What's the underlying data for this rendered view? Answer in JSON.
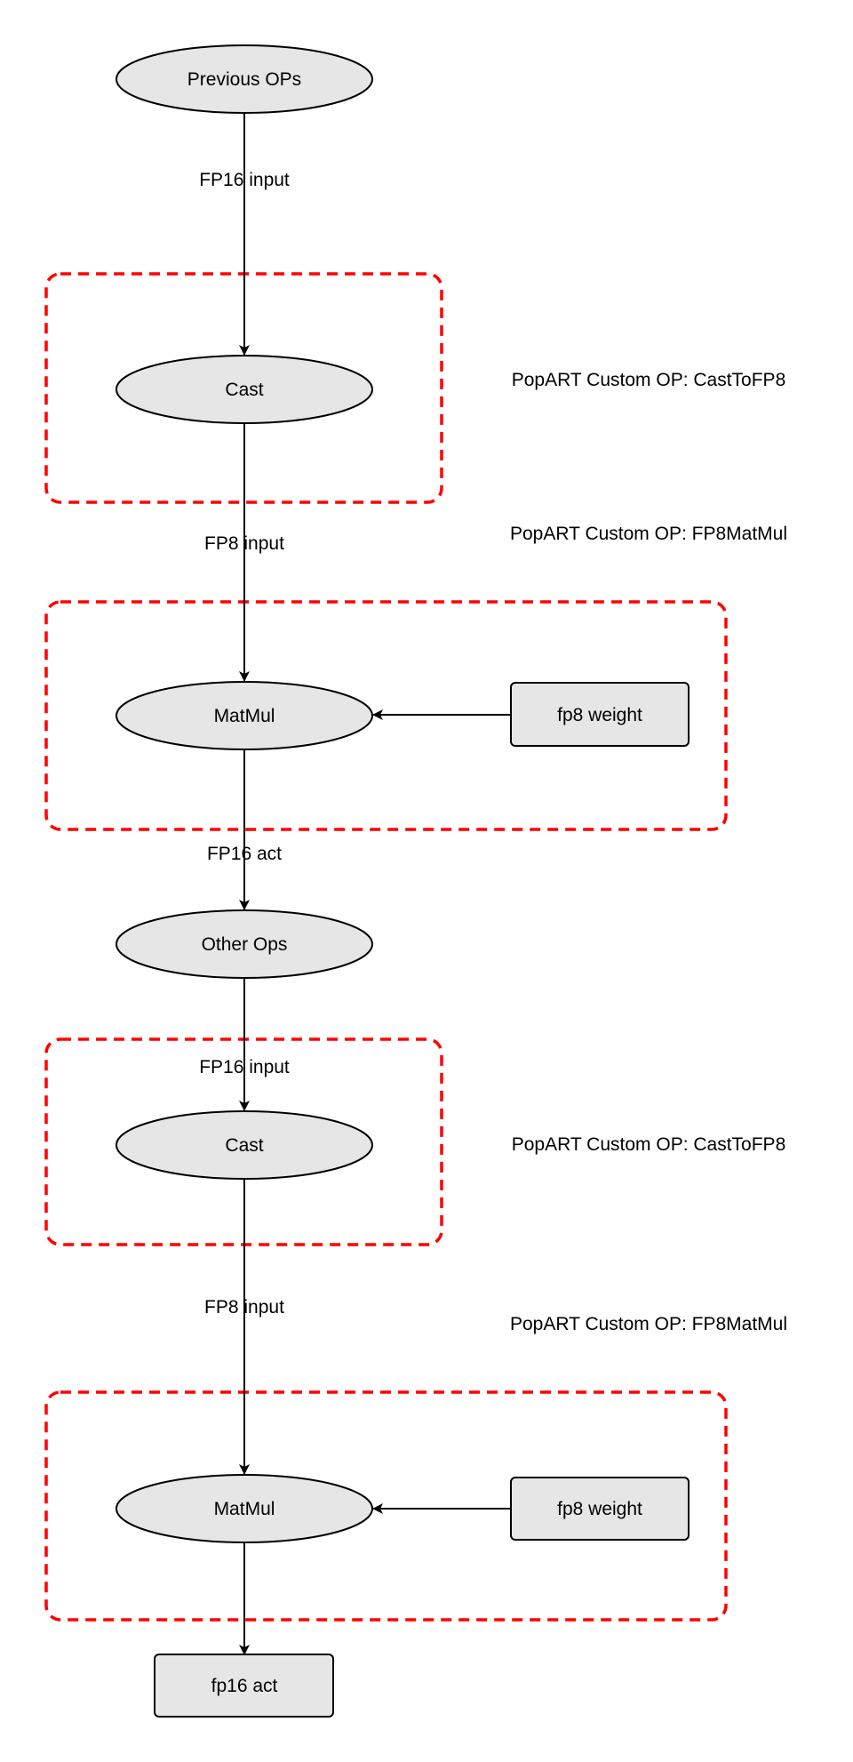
{
  "diagram": {
    "nodes": {
      "previous_ops": {
        "label": "Previous OPs",
        "shape": "ellipse"
      },
      "cast_1": {
        "label": "Cast",
        "shape": "ellipse"
      },
      "matmul_1": {
        "label": "MatMul",
        "shape": "ellipse"
      },
      "weight_1": {
        "label": "fp8 weight",
        "shape": "rounded-rect"
      },
      "other_ops": {
        "label": "Other Ops",
        "shape": "ellipse"
      },
      "cast_2": {
        "label": "Cast",
        "shape": "ellipse"
      },
      "matmul_2": {
        "label": "MatMul",
        "shape": "ellipse"
      },
      "weight_2": {
        "label": "fp8 weight",
        "shape": "rounded-rect"
      },
      "fp16_act": {
        "label": "fp16 act",
        "shape": "rounded-rect"
      }
    },
    "edges": {
      "e1": {
        "from": "previous_ops",
        "to": "cast_1",
        "label": "FP16 input"
      },
      "e2": {
        "from": "cast_1",
        "to": "matmul_1",
        "label": "FP8 input"
      },
      "e3": {
        "from": "weight_1",
        "to": "matmul_1",
        "label": ""
      },
      "e4": {
        "from": "matmul_1",
        "to": "other_ops",
        "label": "FP16 act"
      },
      "e5": {
        "from": "other_ops",
        "to": "cast_2",
        "label": "FP16 input"
      },
      "e6": {
        "from": "cast_2",
        "to": "matmul_2",
        "label": "FP8 input"
      },
      "e7": {
        "from": "weight_2",
        "to": "matmul_2",
        "label": ""
      },
      "e8": {
        "from": "matmul_2",
        "to": "fp16_act",
        "label": ""
      }
    },
    "groups": {
      "g1": {
        "label": "PopART Custom OP: CastToFP8",
        "contains": [
          "cast_1"
        ]
      },
      "g2": {
        "label": "PopART Custom OP: FP8MatMul",
        "contains": [
          "matmul_1",
          "weight_1"
        ]
      },
      "g3": {
        "label": "PopART Custom OP: CastToFP8",
        "contains": [
          "cast_2"
        ]
      },
      "g4": {
        "label": "PopART Custom OP: FP8MatMul",
        "contains": [
          "matmul_2",
          "weight_2"
        ]
      }
    },
    "colors": {
      "node_fill": "#e6e6e6",
      "node_stroke": "#000000",
      "group_stroke": "#ff0000",
      "edge": "#000000"
    }
  }
}
